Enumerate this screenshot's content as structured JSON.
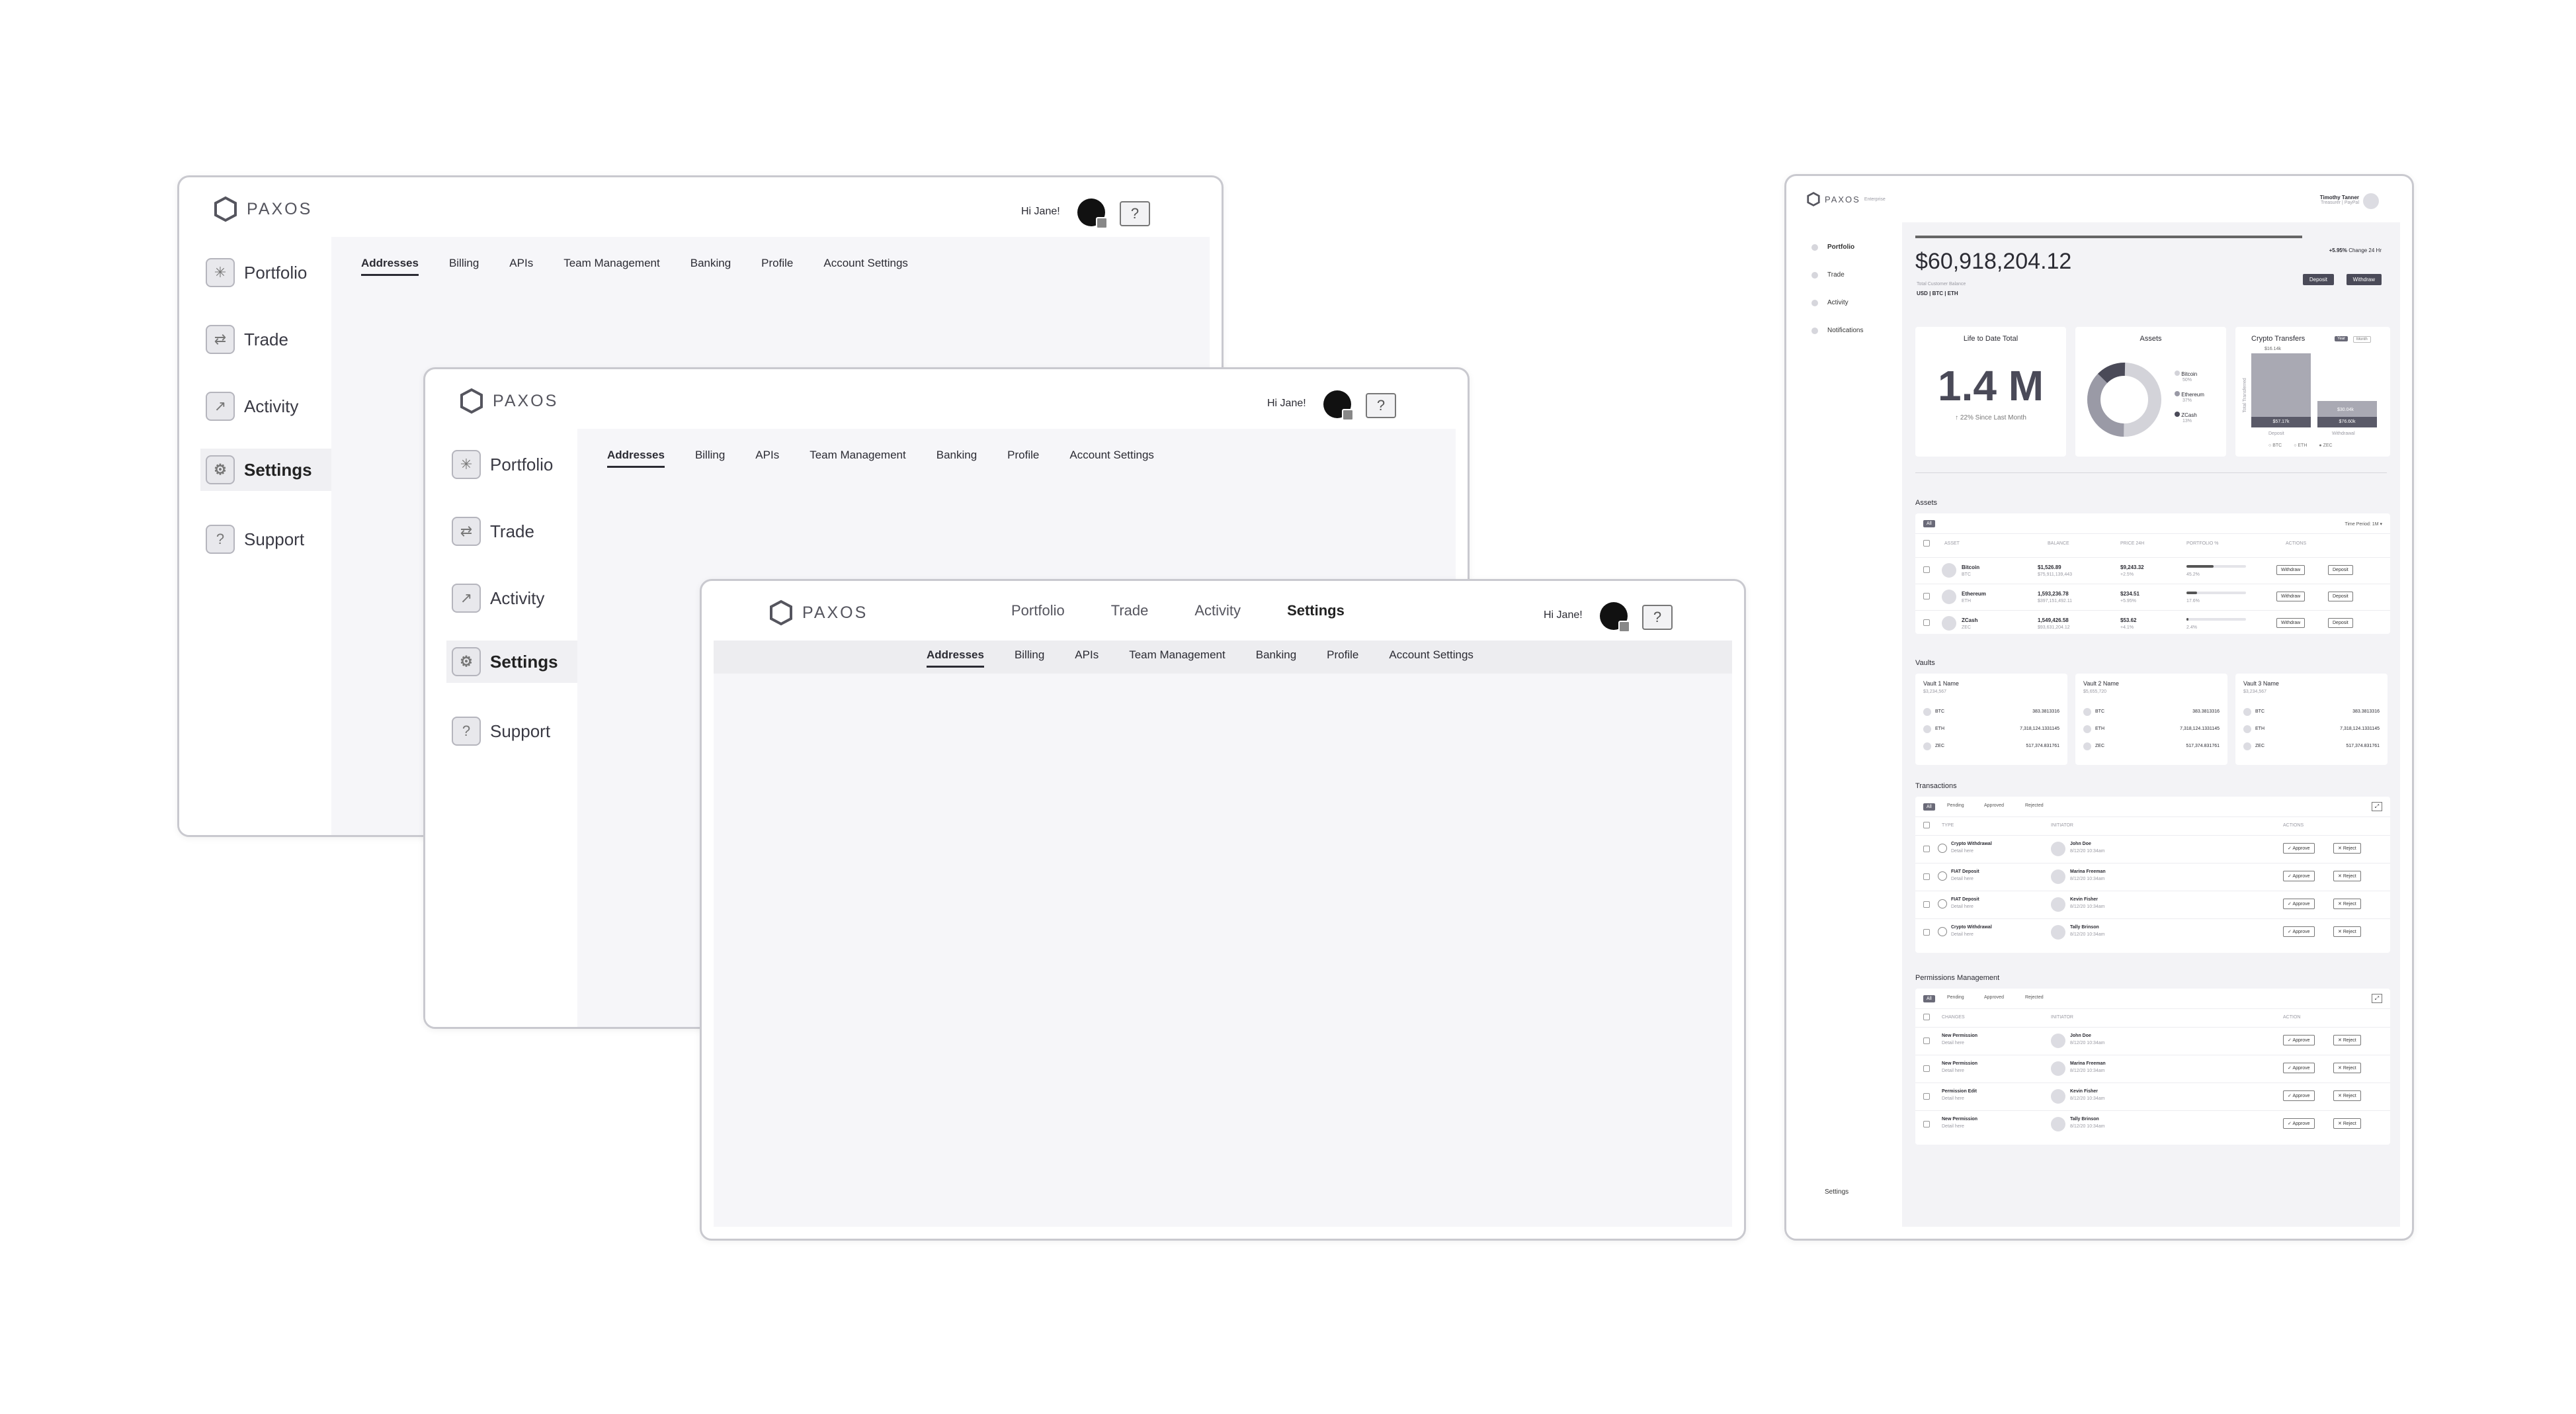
{
  "brand": {
    "logo": "PAXOS",
    "accent": "#4a4a58"
  },
  "greeting": "Hi Jane!",
  "help_icon": "question-bubble-icon",
  "side_nav": [
    {
      "label": "Portfolio",
      "icon": "portfolio-icon"
    },
    {
      "label": "Trade",
      "icon": "trade-icon"
    },
    {
      "label": "Activity",
      "icon": "activity-icon"
    },
    {
      "label": "Settings",
      "icon": "gear-icon"
    },
    {
      "label": "Support",
      "icon": "support-icon"
    }
  ],
  "settings_tabs": [
    "Addresses",
    "Billing",
    "APIs",
    "Team Management",
    "Banking",
    "Profile",
    "Account Settings"
  ],
  "top_nav": [
    "Portfolio",
    "Trade",
    "Activity",
    "Settings"
  ],
  "dashboard": {
    "logo": "PAXOS",
    "logo_sub": "Enterprise",
    "user_name": "Timothy Tanner",
    "user_role": "Treasurer | PayPal",
    "nav": [
      "Portfolio",
      "Trade",
      "Activity",
      "Notifications"
    ],
    "footer_nav": "Settings",
    "change": "+5.95%",
    "change_label": "Change 24 Hr",
    "balance": "$60,918,204.12",
    "balance_label": "Total Customer Balance",
    "currency_toggle": "USD | BTC | ETH",
    "deposit": "Deposit",
    "withdraw": "Withdraw",
    "ltd": {
      "title": "Life to Date Total",
      "value": "1.4 M",
      "delta": "22% Since Last Month"
    },
    "assets_card": {
      "title": "Assets",
      "legend": [
        {
          "name": "Bitcoin",
          "sub": "50%"
        },
        {
          "name": "Ethereum",
          "sub": "37%"
        },
        {
          "name": "ZCash",
          "sub": "13%"
        }
      ],
      "colors": [
        "#d3d3d9",
        "#9a9aa6",
        "#4a4a58"
      ]
    },
    "transfers": {
      "title": "Crypto Transfers",
      "toggle_on": "Year",
      "toggle_off": "Month",
      "axis": "Total Transferred",
      "bars": [
        {
          "label": "Deposit",
          "total": "$16.14k",
          "bottom": "$57.17k"
        },
        {
          "label": "Withdrawal",
          "total": "$30.04k",
          "bottom": "$76.60k"
        }
      ],
      "legend": [
        "BTC",
        "ETH",
        "ZEC"
      ]
    },
    "assets": {
      "title": "Assets",
      "filter": "All",
      "period": "Time Period: 1M",
      "columns": [
        "ASSET",
        "BALANCE",
        "PRICE 24H",
        "PORTFOLIO %",
        "ACTIONS"
      ],
      "rows": [
        {
          "name": "Bitcoin",
          "sym": "BTC",
          "bal": "$1,526.89",
          "bal2": "$75,911,139,443",
          "price": "$9,243.32",
          "chg": "+2.5%",
          "pct": "45.2%",
          "pv": 0.45
        },
        {
          "name": "Ethereum",
          "sym": "ETH",
          "bal": "1,593,236.78",
          "bal2": "$397,151,492.11",
          "price": "$234.51",
          "chg": "+5.95%",
          "pct": "17.6%",
          "pv": 0.18
        },
        {
          "name": "ZCash",
          "sym": "ZEC",
          "bal": "1,549,426.58",
          "bal2": "$93,631,204.12",
          "price": "$53.62",
          "chg": "+4.1%",
          "pct": "2.4%",
          "pv": 0.03
        }
      ],
      "withdraw": "Withdraw",
      "deposit": "Deposit"
    },
    "vaults": {
      "title": "Vaults",
      "items": [
        {
          "name": "Vault 1 Name",
          "val": "$3,234,567"
        },
        {
          "name": "Vault 2 Name",
          "val": "$5,655,720"
        },
        {
          "name": "Vault 3 Name",
          "val": "$3,234,567"
        }
      ],
      "coins": [
        {
          "c": "BTC",
          "v": "383.3813316"
        },
        {
          "c": "ETH",
          "v": "7,318,124.1331145"
        },
        {
          "c": "ZEC",
          "v": "517,374.831761"
        }
      ]
    },
    "transactions": {
      "title": "Transactions",
      "filters": [
        "All",
        "Pending",
        "Approved",
        "Rejected"
      ],
      "columns": [
        "TYPE",
        "INITIATOR",
        "ACTIONS"
      ],
      "rows": [
        {
          "type": "Crypto Withdrawal",
          "who": "John Doe"
        },
        {
          "type": "FIAT Deposit",
          "who": "Marina Freeman"
        },
        {
          "type": "FIAT Deposit",
          "who": "Kevin Fisher"
        },
        {
          "type": "Crypto Withdrawal",
          "who": "Tally Brinson"
        }
      ],
      "detail": "Detail here",
      "date": "8/12/20 10:34am",
      "approve": "Approve",
      "reject": "Reject"
    },
    "permissions": {
      "title": "Permissions Management",
      "filters": [
        "All",
        "Pending",
        "Approved",
        "Rejected"
      ],
      "columns": [
        "CHANGES",
        "INITIATOR",
        "ACTION"
      ],
      "rows": [
        {
          "type": "New Permission",
          "who": "John Doe"
        },
        {
          "type": "New Permission",
          "who": "Marina Freeman"
        },
        {
          "type": "Permission Edit",
          "who": "Kevin Fisher"
        },
        {
          "type": "New Permission",
          "who": "Tally Brinson"
        }
      ]
    }
  }
}
